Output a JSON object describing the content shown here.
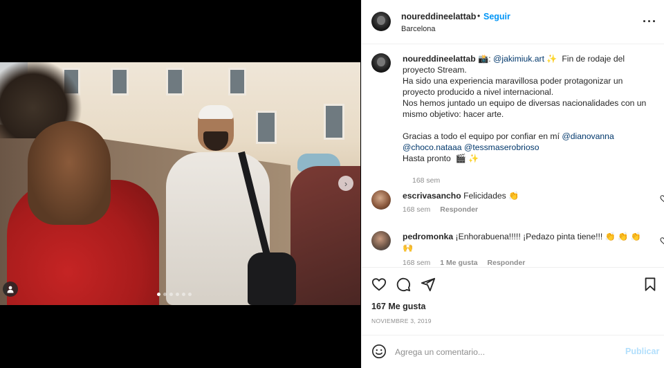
{
  "post": {
    "username": "noureddineelattab",
    "follow_label": "Seguir",
    "separator": "•",
    "location": "Barcelona",
    "more_icon": "more-horizontal-icon",
    "media": {
      "slide_count": 6,
      "active_slide": 1,
      "next_icon": "chevron-right-icon",
      "tag_icon": "user-tag-icon"
    },
    "caption": {
      "username": "noureddineelattab",
      "text_a": " 📸: ",
      "mention_1": "@jakimiuk.art",
      "text_b": " ✨  Fin de rodaje del proyecto Stream.\nHa sido una experiencia maravillosa poder protagonizar un proyecto producido a nivel internacional.\nNos hemos juntado un equipo de diversas nacionalidades con un mismo objetivo: hacer arte.\n\nGracias a todo el equipo por confiar en mí ",
      "mention_2": "@dianovanna",
      "text_c": "\n",
      "mention_3": "@choco.nataaa",
      "text_d": " ",
      "mention_4": "@tessmaserobrioso",
      "text_e": "\nHasta pronto  🎬 ✨",
      "time": "168 sem"
    },
    "comments": [
      {
        "username": "escrivasancho",
        "text": " Felicidades  👏",
        "time": "168 sem",
        "reply_label": "Responder",
        "likes_label": ""
      },
      {
        "username": "pedromonka",
        "text": " ¡Enhorabuena!!!!! ¡Pedazo pinta tiene!!! 👏 👏 👏 🙌",
        "time": "168 sem",
        "likes_label": "1 Me gusta",
        "reply_label": "Responder"
      }
    ],
    "likes_text": "167 Me gusta",
    "date": "NOVIEMBRE 3, 2019",
    "comment_placeholder": "Agrega un comentario...",
    "publish_label": "Publicar"
  },
  "colors": {
    "accent": "#0095f6",
    "publish_disabled": "#b2dffc",
    "mention": "#00376b",
    "secondary_text": "#8e8e8e"
  }
}
